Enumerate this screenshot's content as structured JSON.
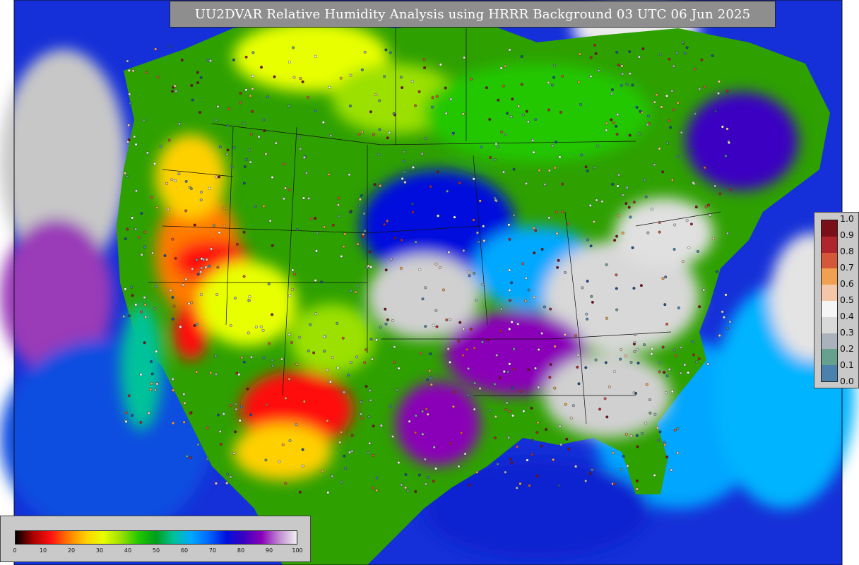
{
  "title": "UU2DVAR Relative Humidity Analysis using HRRR Background 03 UTC 06 Jun 2025",
  "colorbar": {
    "ticks": [
      "0",
      "10",
      "20",
      "30",
      "40",
      "50",
      "60",
      "70",
      "80",
      "90",
      "100"
    ],
    "colors": [
      "#000000",
      "#aa0000",
      "#ff1010",
      "#ff7a00",
      "#ffd000",
      "#e8ff00",
      "#9be000",
      "#21c700",
      "#009e1b",
      "#00c29a",
      "#00a8ff",
      "#0066ff",
      "#0010dd",
      "#3a00c2",
      "#8a00b8",
      "#c08ad0",
      "#f0f0f0"
    ]
  },
  "obs_legend": {
    "labels": [
      "1.0",
      "0.9",
      "0.8",
      "0.7",
      "0.6",
      "0.5",
      "0.4",
      "0.3",
      "0.2",
      "0.1",
      "0.0"
    ],
    "colors": [
      "#7a0f1a",
      "#b0242e",
      "#d4573a",
      "#f0a050",
      "#f3c7a8",
      "#f5f5f5",
      "#d9d9d9",
      "#aab3bb",
      "#66a08f",
      "#4a82ad",
      "#1b4f8f"
    ]
  }
}
